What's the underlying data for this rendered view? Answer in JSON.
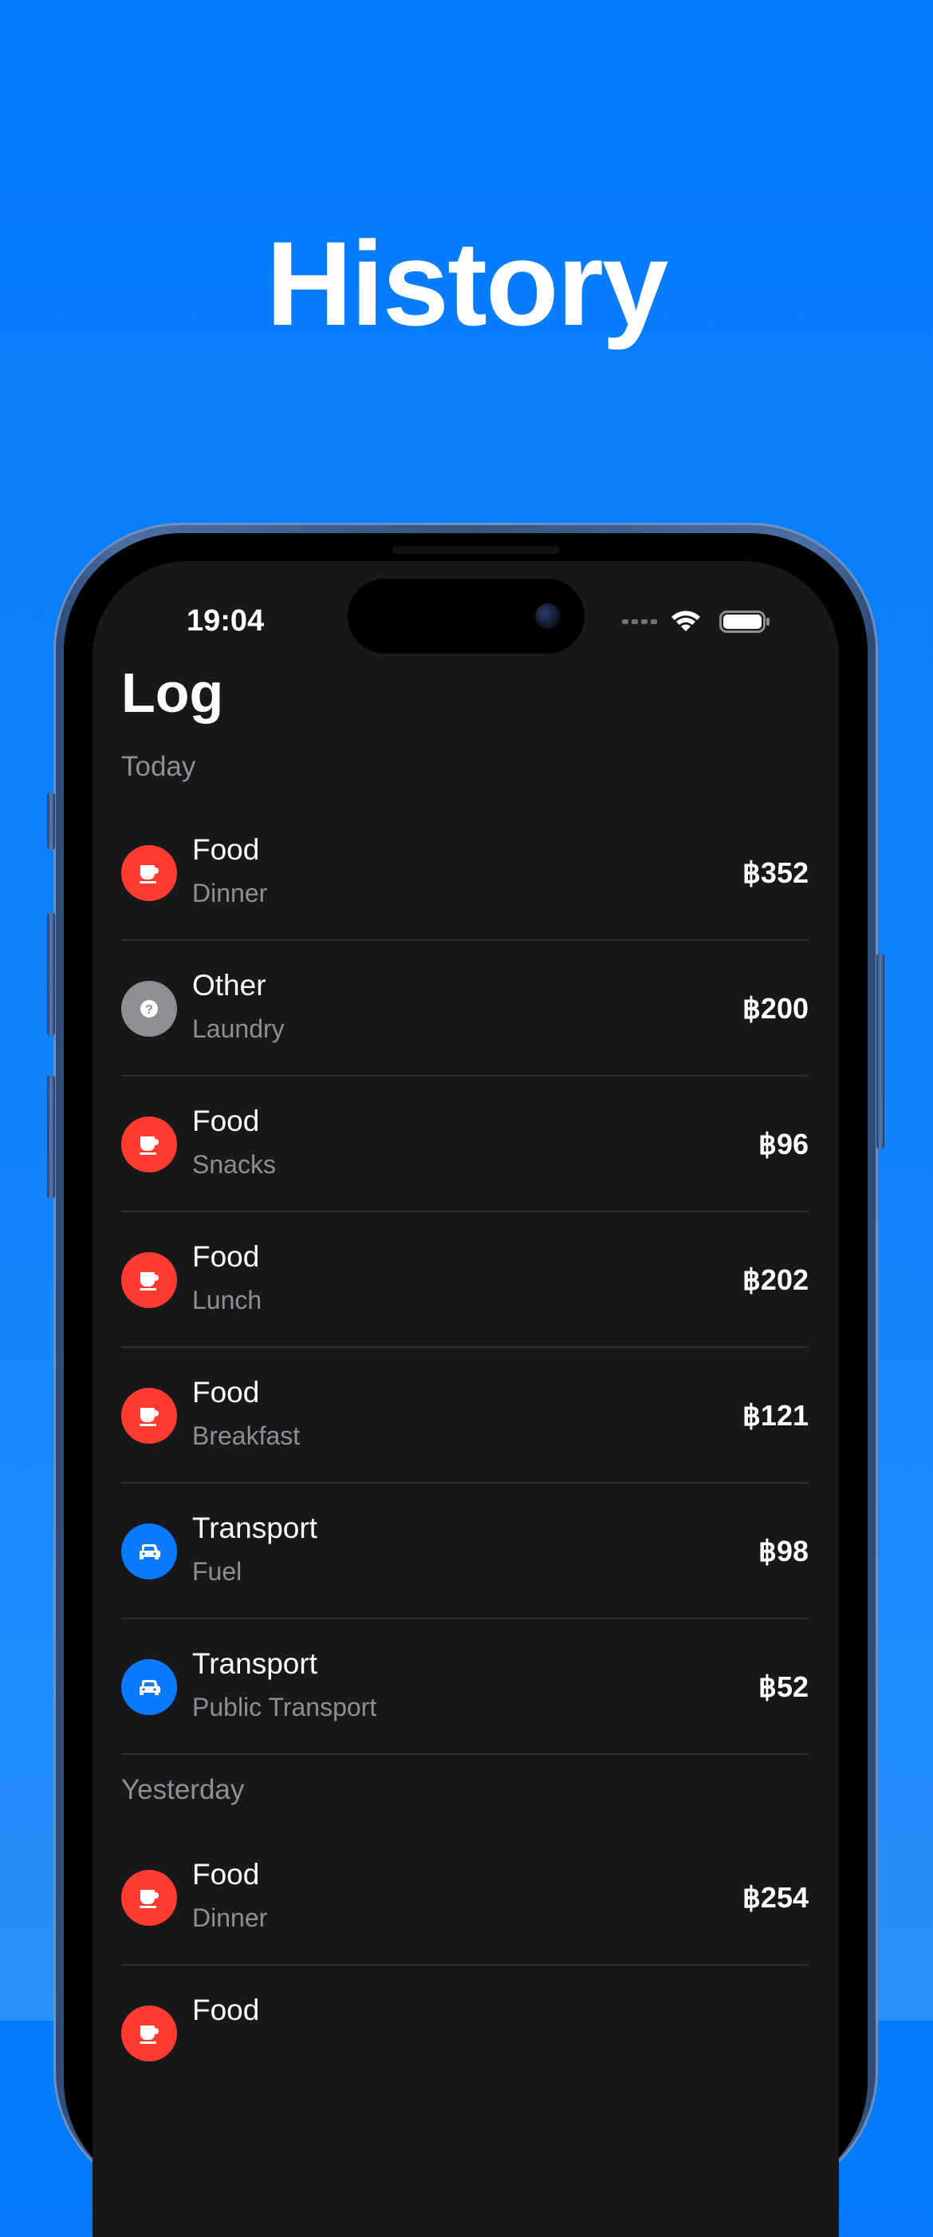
{
  "promo": {
    "headline": "History"
  },
  "status_bar": {
    "time": "19:04"
  },
  "screen": {
    "title": "Log"
  },
  "sections": [
    {
      "header": "Today",
      "items": [
        {
          "category": "Food",
          "note": "Dinner",
          "amount": "฿352",
          "icon": "cup-icon",
          "color": "#FF3B30"
        },
        {
          "category": "Other",
          "note": "Laundry",
          "amount": "฿200",
          "icon": "question-icon",
          "color": "#8E8E93"
        },
        {
          "category": "Food",
          "note": "Snacks",
          "amount": "฿96",
          "icon": "cup-icon",
          "color": "#FF3B30"
        },
        {
          "category": "Food",
          "note": "Lunch",
          "amount": "฿202",
          "icon": "cup-icon",
          "color": "#FF3B30"
        },
        {
          "category": "Food",
          "note": "Breakfast",
          "amount": "฿121",
          "icon": "cup-icon",
          "color": "#FF3B30"
        },
        {
          "category": "Transport",
          "note": "Fuel",
          "amount": "฿98",
          "icon": "car-icon",
          "color": "#0A7AFF"
        },
        {
          "category": "Transport",
          "note": "Public Transport",
          "amount": "฿52",
          "icon": "car-icon",
          "color": "#0A7AFF"
        }
      ]
    },
    {
      "header": "Yesterday",
      "items": [
        {
          "category": "Food",
          "note": "Dinner",
          "amount": "฿254",
          "icon": "cup-icon",
          "color": "#FF3B30"
        },
        {
          "category": "Food",
          "note": "",
          "amount": "",
          "icon": "cup-icon",
          "color": "#FF3B30"
        }
      ]
    }
  ],
  "colors": {
    "background_blue": "#037BFB",
    "screen_background": "#18181A",
    "food": "#FF3B30",
    "transport": "#0A7AFF",
    "other": "#8E8E93"
  }
}
